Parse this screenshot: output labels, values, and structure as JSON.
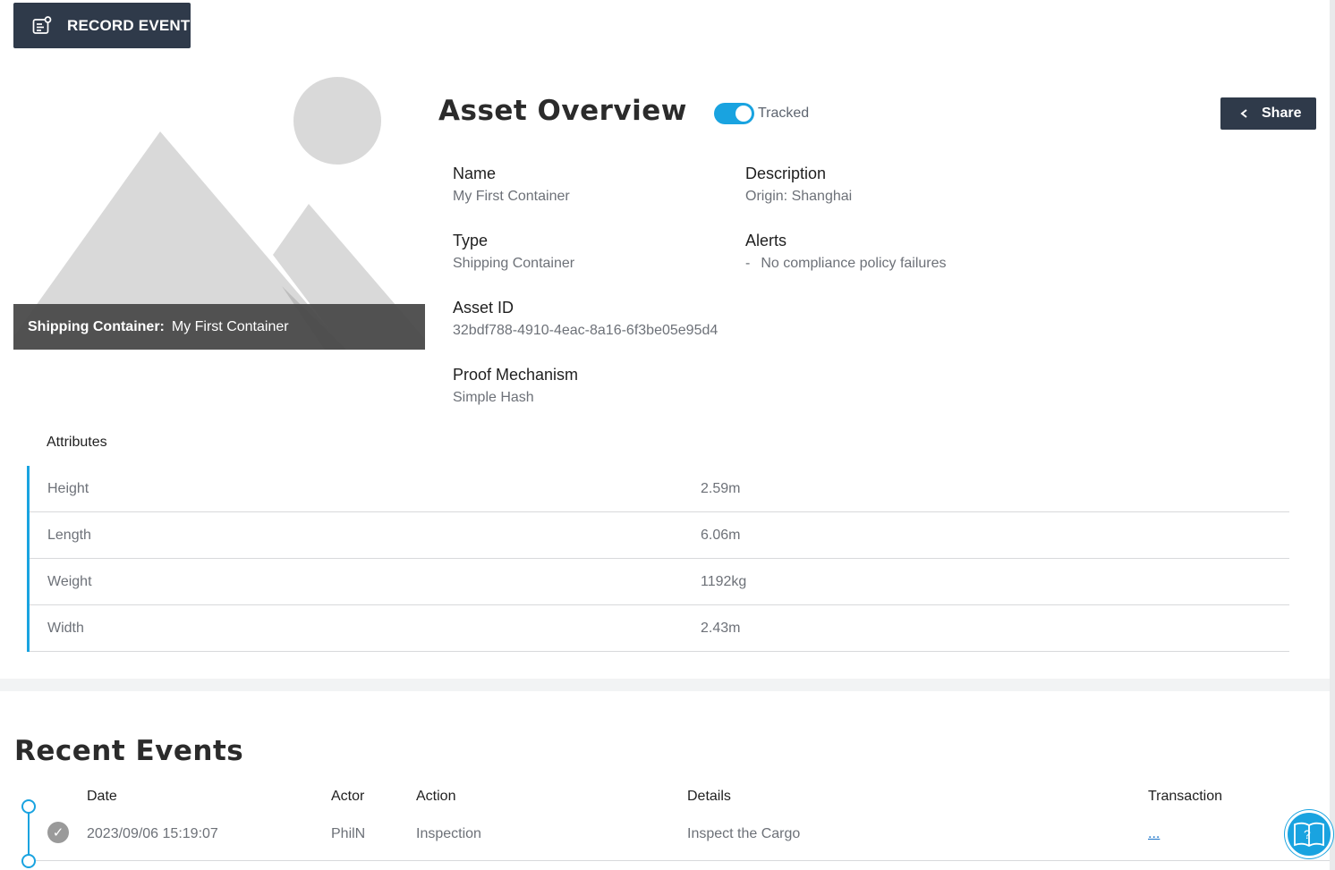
{
  "toolbar": {
    "record_event_label": "RECORD EVENT",
    "record_event_icon": "record-event-icon"
  },
  "hero": {
    "caption_type": "Shipping Container:",
    "caption_name": "My First Container",
    "placeholder_icon": "image-placeholder-icon"
  },
  "overview": {
    "title": "Asset Overview",
    "tracked_label": "Tracked",
    "tracked_on": true,
    "share_label": "Share",
    "fields": {
      "name": {
        "label": "Name",
        "value": "My First Container"
      },
      "description": {
        "label": "Description",
        "value": "Origin: Shanghai"
      },
      "type": {
        "label": "Type",
        "value": "Shipping Container"
      },
      "alerts": {
        "label": "Alerts",
        "dash": "-",
        "value": "No compliance policy failures"
      },
      "asset_id": {
        "label": "Asset ID",
        "value": "32bdf788-4910-4eac-8a16-6f3be05e95d4"
      },
      "proof": {
        "label": "Proof Mechanism",
        "value": "Simple Hash"
      }
    }
  },
  "attributes": {
    "title": "Attributes",
    "rows": [
      {
        "key": "Height",
        "value": "2.59m"
      },
      {
        "key": "Length",
        "value": "6.06m"
      },
      {
        "key": "Weight",
        "value": "1192kg"
      },
      {
        "key": "Width",
        "value": "2.43m"
      }
    ]
  },
  "events": {
    "title": "Recent Events",
    "columns": {
      "date": "Date",
      "actor": "Actor",
      "action": "Action",
      "details": "Details",
      "transaction": "Transaction"
    },
    "rows": [
      {
        "status_icon": "check-icon",
        "date": "2023/09/06 15:19:07",
        "actor": "PhilN",
        "action": "Inspection",
        "details": "Inspect the Cargo",
        "transaction": "..."
      }
    ]
  },
  "colors": {
    "accent": "#19a3e0",
    "dark_button": "#2f3a4a",
    "link": "#1a73c9"
  }
}
